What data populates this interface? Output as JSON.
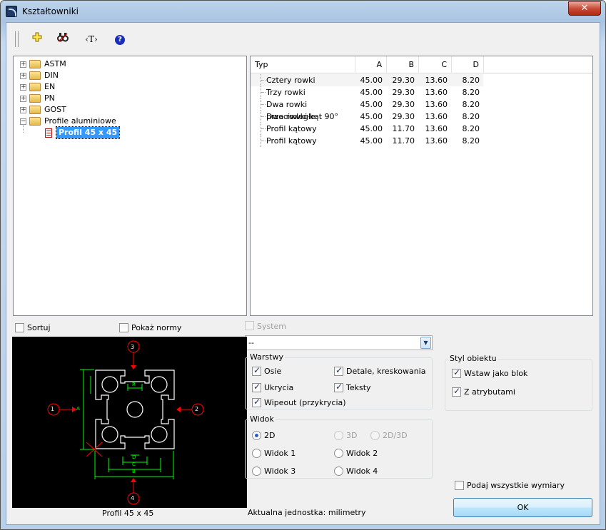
{
  "window": {
    "title": "Kształtowniki",
    "close_label": "✕"
  },
  "toolbar": {
    "icons": [
      "add-icon",
      "binoculars-icon",
      "text-icon",
      "help-icon"
    ],
    "text_label": "‹T›",
    "help_label": "?"
  },
  "tree": {
    "items": [
      {
        "label": "ASTM",
        "expanded": false
      },
      {
        "label": "DIN",
        "expanded": false
      },
      {
        "label": "EN",
        "expanded": false
      },
      {
        "label": "PN",
        "expanded": false
      },
      {
        "label": "GOST",
        "expanded": false
      },
      {
        "label": "Profile aluminiowe",
        "expanded": true
      }
    ],
    "selected_child": "Profil 45 x 45"
  },
  "table": {
    "headers": [
      "Typ",
      "A",
      "B",
      "C",
      "D"
    ],
    "rows": [
      [
        "Cztery rowki",
        "45.00",
        "29.30",
        "13.60",
        "8.20"
      ],
      [
        "Trzy rowki",
        "45.00",
        "29.30",
        "13.60",
        "8.20"
      ],
      [
        "Dwa rowki przeciwległe",
        "45.00",
        "29.30",
        "13.60",
        "8.20"
      ],
      [
        "Dwa rowki kąt 90°",
        "45.00",
        "29.30",
        "13.60",
        "8.20"
      ],
      [
        "Profil kątowy",
        "45.00",
        "11.70",
        "13.60",
        "8.20"
      ],
      [
        "Profil kątowy",
        "45.00",
        "11.70",
        "13.60",
        "8.20"
      ]
    ]
  },
  "options": {
    "sortuj": "Sortuj",
    "pokaz_normy": "Pokaż normy",
    "system": "System",
    "combo_value": "--"
  },
  "warstwy": {
    "title": "Warstwy",
    "osie": "Osie",
    "detale": "Detale, kreskowania",
    "ukrycia": "Ukrycia",
    "teksty": "Teksty",
    "wipeout": "Wipeout (przykrycia)"
  },
  "styl": {
    "title": "Styl obiektu",
    "wstaw": "Wstaw jako blok",
    "atrybuty": "Z atrybutami"
  },
  "widok": {
    "title": "Widok",
    "options": [
      "2D",
      "3D",
      "2D/3D",
      "Widok 1",
      "Widok 2",
      "Widok 3",
      "Widok 4"
    ],
    "selected": "2D"
  },
  "preview": {
    "caption": "Profil 45 x 45",
    "view_markers": [
      "1",
      "2",
      "3",
      "4"
    ],
    "dim_labels": [
      "A",
      "B",
      "C",
      "D",
      "R"
    ],
    "colors": {
      "outline": "#ffffff",
      "dimension": "#00ff00",
      "marker": "#ff0000"
    }
  },
  "footer": {
    "podaj": "Podaj wszystkie wymiary",
    "unit": "Aktualna jednostka: milimetry",
    "ok": "OK"
  }
}
